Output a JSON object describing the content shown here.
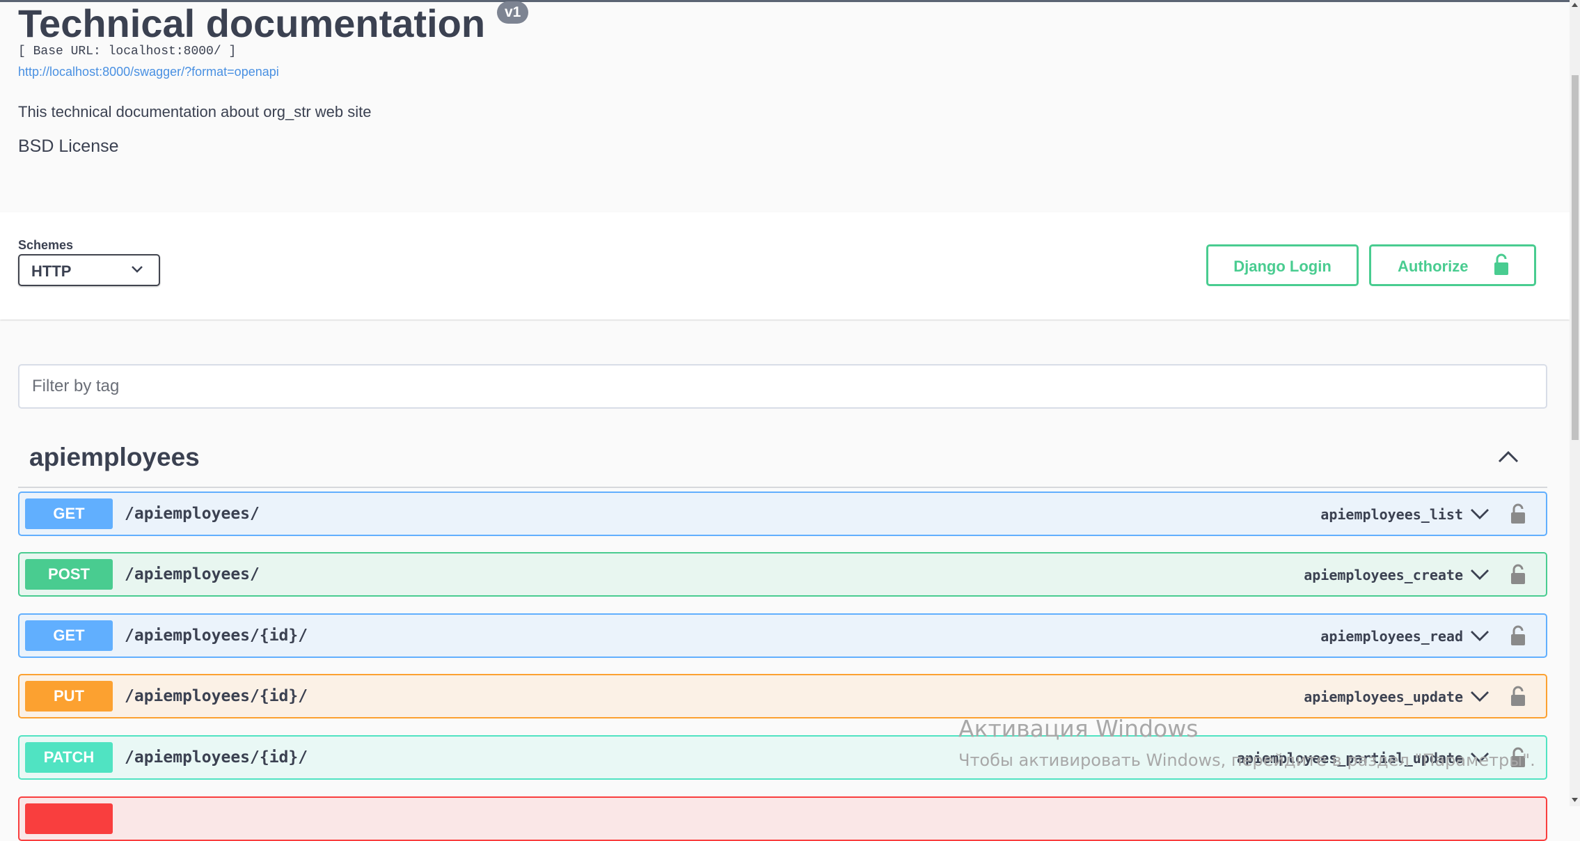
{
  "info": {
    "title": "Technical documentation",
    "version": "v1",
    "base_url": "[ Base URL: localhost:8000/ ]",
    "spec_link": "http://localhost:8000/swagger/?format=openapi",
    "description": "This technical documentation about org_str web site",
    "license": "BSD License"
  },
  "scheme_bar": {
    "schemes_label": "Schemes",
    "selected_scheme": "HTTP",
    "django_login_label": "Django Login",
    "authorize_label": "Authorize"
  },
  "filter": {
    "placeholder": "Filter by tag"
  },
  "tag": {
    "name": "apiemployees",
    "operations": [
      {
        "method": "GET",
        "path": "/apiemployees/",
        "operation_id": "apiemployees_list"
      },
      {
        "method": "POST",
        "path": "/apiemployees/",
        "operation_id": "apiemployees_create"
      },
      {
        "method": "GET",
        "path": "/apiemployees/{id}/",
        "operation_id": "apiemployees_read"
      },
      {
        "method": "PUT",
        "path": "/apiemployees/{id}/",
        "operation_id": "apiemployees_update"
      },
      {
        "method": "PATCH",
        "path": "/apiemployees/{id}/",
        "operation_id": "apiemployees_partial_update"
      }
    ]
  },
  "watermark": {
    "line1": "Активация Windows",
    "line2": "Чтобы активировать Windows, перейдите в раздел \"Параметры\"."
  },
  "colors": {
    "get": "#61affe",
    "post": "#49cc90",
    "put": "#fca130",
    "patch": "#50e3c2",
    "delete": "#f93e3e",
    "link": "#4990e2",
    "text": "#3b4151"
  },
  "icons": {
    "scheme_dropdown": "chevron-down-icon",
    "authorize": "lock-icon",
    "tag_toggle": "chevron-up-icon",
    "operation_expand": "chevron-down-icon",
    "operation_auth": "lock-icon"
  }
}
